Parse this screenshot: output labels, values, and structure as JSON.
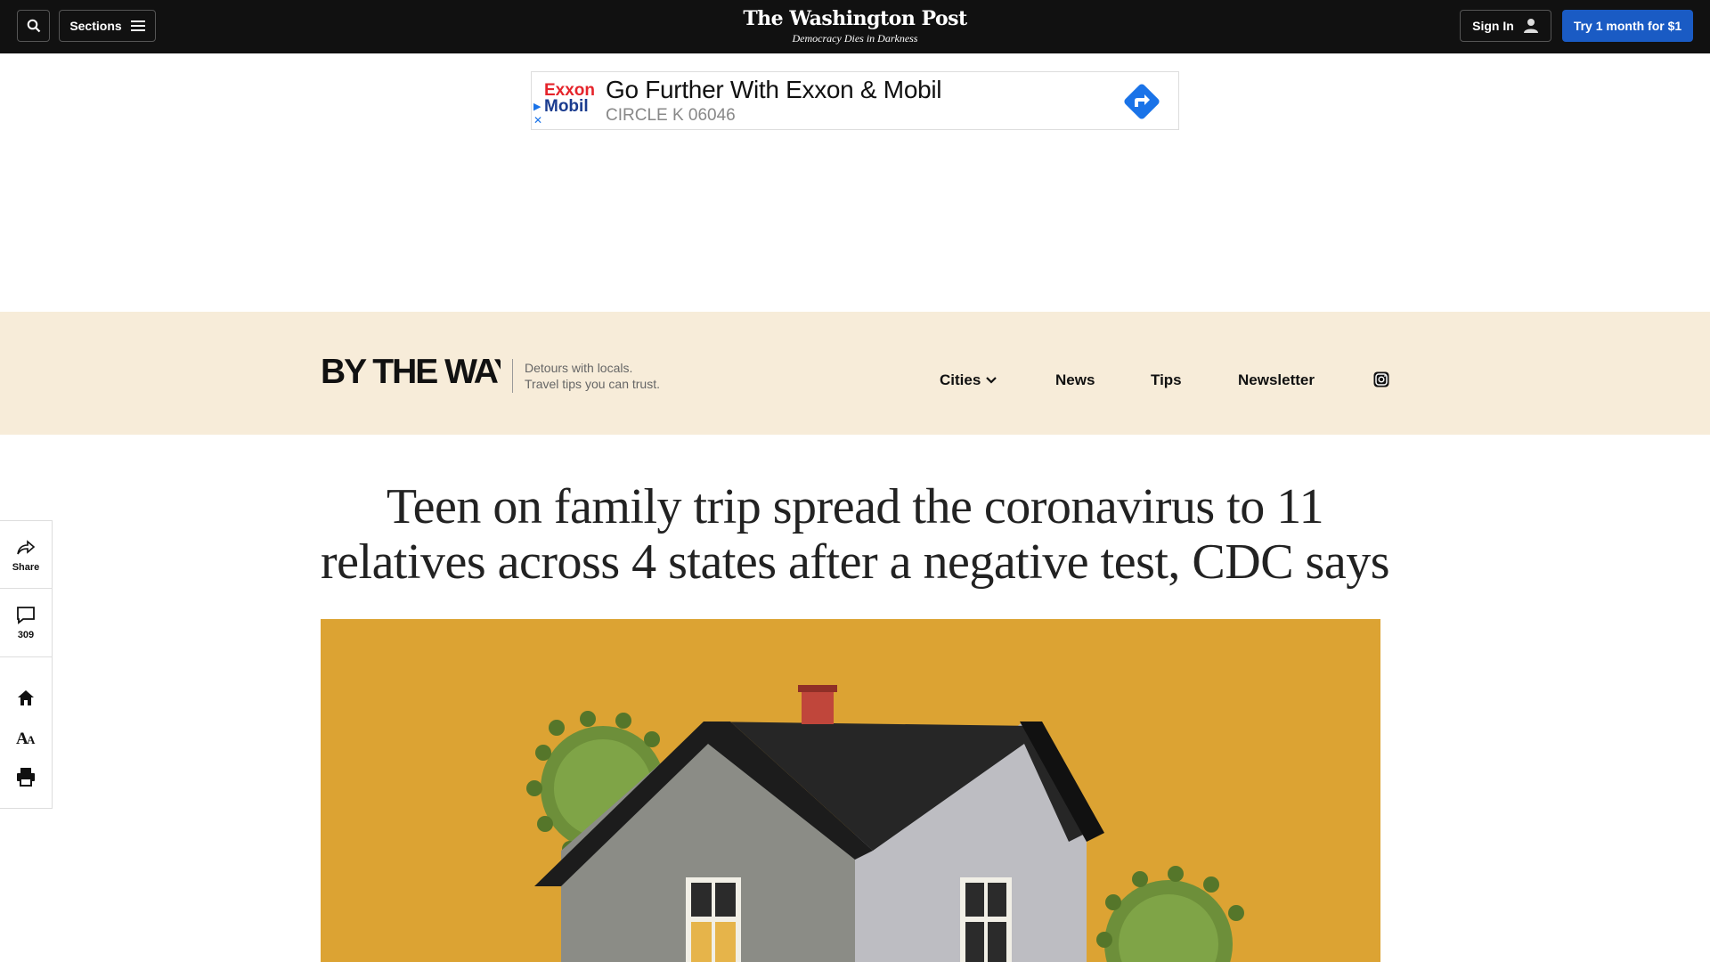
{
  "topbar": {
    "sections_label": "Sections",
    "masthead": "The Washington Post",
    "tagline": "Democracy Dies in Darkness",
    "signin_label": "Sign In",
    "subscribe_label": "Try 1 month for $1"
  },
  "ad": {
    "logo_top": "Exxon",
    "logo_bottom": "Mobil",
    "headline": "Go Further With Exxon & Mobil",
    "subline": "CIRCLE K 06046",
    "close_glyph": "✕"
  },
  "section_banner": {
    "logo_text": "BY THE WAY",
    "tagline_line1": "Detours with locals.",
    "tagline_line2": "Travel tips you can trust.",
    "nav": [
      "Cities",
      "News",
      "Tips",
      "Newsletter"
    ],
    "social_icon": "instagram-icon"
  },
  "article": {
    "headline": "Teen on family trip spread the coronavirus to 11 relatives across 4 states after a negative test, CDC says"
  },
  "rail": {
    "share_label": "Share",
    "comments_count": "309",
    "icons": [
      "share-icon",
      "comment-icon",
      "home-icon",
      "text-size-icon",
      "print-icon"
    ]
  },
  "colors": {
    "topbar_bg": "#111111",
    "subscribe_bg": "#1a5bc4",
    "banner_bg": "#f7ecd9",
    "hero_bg": "#dca333",
    "exxon_red": "#e5242b",
    "mobil_blue": "#1b3c8f",
    "ad_arrow": "#1a73e8"
  }
}
